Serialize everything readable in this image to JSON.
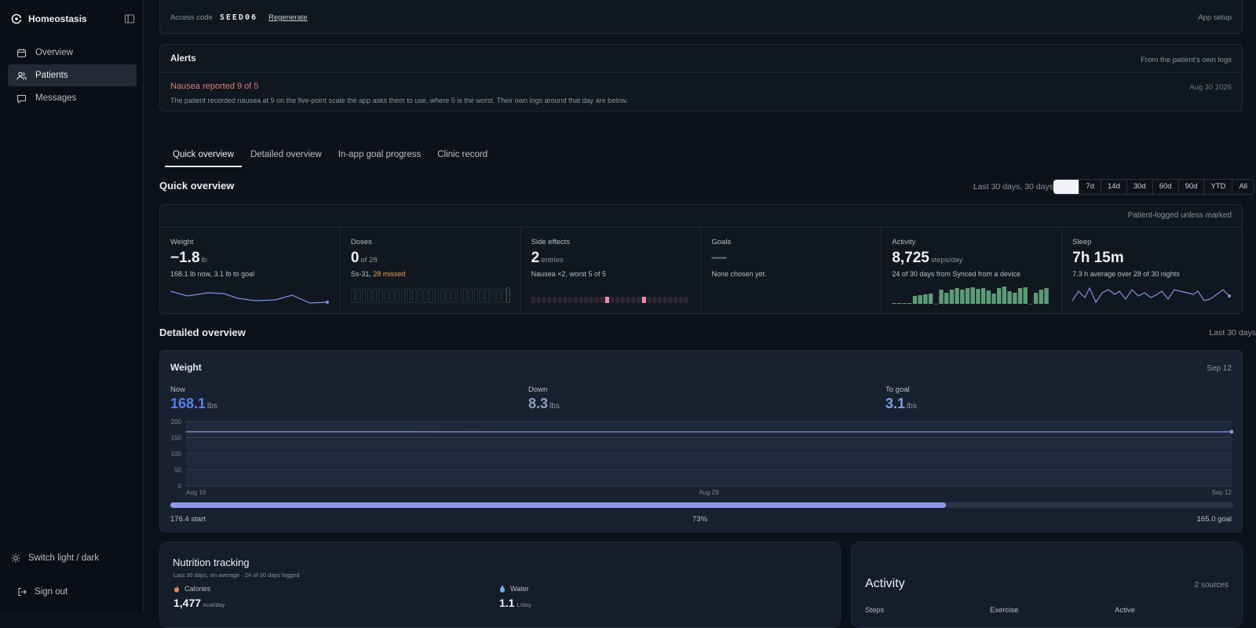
{
  "app": {
    "name": "Homeostasis"
  },
  "sidebar": {
    "items": [
      {
        "label": "Overview",
        "icon": "calendar-icon"
      },
      {
        "label": "Patients",
        "icon": "users-icon",
        "active": true
      },
      {
        "label": "Messages",
        "icon": "message-icon"
      }
    ],
    "theme_label": "Switch light / dark",
    "signout_label": "Sign out"
  },
  "access": {
    "label": "Access code",
    "code": "SEED06",
    "regenerate": "Regenerate",
    "setup": "App setup"
  },
  "alerts": {
    "title": "Alerts",
    "source": "From the patient's own logs",
    "item": {
      "title": "Nausea reported 9 of 5",
      "date": "Aug 30 2026",
      "text": "The patient recorded nausea at 9 on the five-point scale the app asks them to use, where 5 is the worst. Their own logs around that day are below."
    }
  },
  "tabs": [
    "Quick overview",
    "Detailed overview",
    "In-app goal progress",
    "Clinic record"
  ],
  "quick": {
    "title": "Quick overview",
    "range_label": "Last 30 days, 30 days",
    "range_options": [
      "30d",
      "7d",
      "14d",
      "30d",
      "60d",
      "90d",
      "YTD",
      "All"
    ],
    "note": "Patient-logged unless marked",
    "cells": {
      "weight": {
        "label": "Weight",
        "value": "−1.8",
        "unit": "lb",
        "sub": "168.1 lb now, 3.1 lb to goal"
      },
      "doses": {
        "label": "Doses",
        "value": "0",
        "unit": "of 28",
        "sub_prefix": "Ss-31,",
        "sub_warn": "28 missed"
      },
      "side": {
        "label": "Side effects",
        "value": "2",
        "unit": "entries",
        "sub": "Nausea ×2, worst 5 of 5"
      },
      "goals": {
        "label": "Goals",
        "value": "—",
        "sub": "None chosen yet."
      },
      "activity": {
        "label": "Activity",
        "value": "8,725",
        "unit": "steps/day",
        "sub": "24 of 30 days from Synced from a device"
      },
      "sleep": {
        "label": "Sleep",
        "value": "7h 15m",
        "sub": "7.3 h average over 28 of 30 nights"
      }
    }
  },
  "detailed": {
    "title": "Detailed overview",
    "range": "Last 30 days",
    "weight": {
      "title": "Weight",
      "date": "Sep 12",
      "now": {
        "label": "Now",
        "value": "168.1",
        "unit": "lbs"
      },
      "down": {
        "label": "Down",
        "value": "8.3",
        "unit": "lbs"
      },
      "to_goal": {
        "label": "To goal",
        "value": "3.1",
        "unit": "lbs"
      },
      "progress_pct": 73,
      "progress_label": "73%",
      "start_label": "176.4 start",
      "goal_label": "165.0 goal"
    }
  },
  "nutrition": {
    "title": "Nutrition tracking",
    "sub": "Last 30 days, on average · 24 of 30 days logged",
    "calories": {
      "label": "Calories",
      "value": "1,477",
      "unit": "kcal/day"
    },
    "water": {
      "label": "Water",
      "value": "1.1",
      "unit": "L/day"
    }
  },
  "activity_card": {
    "title": "Activity",
    "sources": "2 sources",
    "cols": [
      "Steps",
      "Exercise",
      "Active"
    ]
  },
  "colors": {
    "accent": "#5b7ff0",
    "alert": "#e07b74",
    "warn": "#e7a35a",
    "steps": "#5e9b78",
    "side_effect": "#e98aa8",
    "progress": "#8d99e8"
  },
  "chart_data": [
    {
      "type": "line",
      "title": "",
      "x": [
        "Aug 16",
        "Aug 29",
        "Sep 12"
      ],
      "series": [
        {
          "values": [
            168.3,
            168.1,
            168.1
          ]
        }
      ],
      "yticks": [
        0,
        50,
        100,
        150,
        200
      ],
      "ylim": [
        0,
        200
      ],
      "grid": true
    }
  ]
}
